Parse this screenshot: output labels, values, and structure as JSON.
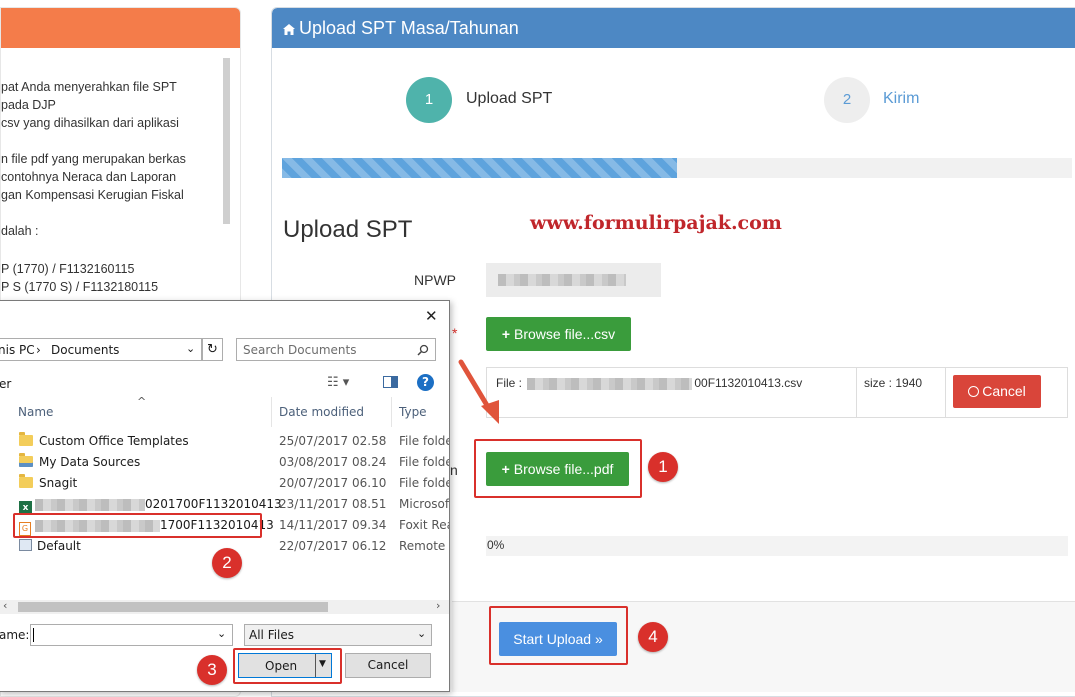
{
  "left_panel": {
    "lines": [
      "pat Anda menyerahkan file SPT",
      "pada DJP",
      "csv yang dihasilkan dari aplikasi",
      "n file pdf yang merupakan berkas",
      "contohnya Neraca dan Laporan",
      "gan Kompensasi Kerugian Fiskal",
      "dalah :",
      "P (1770) / F1132160115",
      "P S (1770 S) / F1132180115"
    ]
  },
  "card": {
    "title": "Upload SPT Masa/Tahunan",
    "steps": [
      {
        "number": "1",
        "label": "Upload SPT"
      },
      {
        "number": "2",
        "label": "Kirim"
      }
    ],
    "progress_percent": 50,
    "watermark": "www.formulirpajak.com",
    "section_title": "Upload SPT",
    "npwp_label": "NPWP",
    "required_mark": "*",
    "browse_csv_label": "Browse file...csv",
    "file_name": "File :",
    "file_name_suffix": "00F1132010413.csv",
    "file_size": "size : 1940",
    "cancel_label": "Cancel",
    "pdf_row_label_tail": "n",
    "browse_pdf_label": "Browse file...pdf",
    "upload_progress": "0%",
    "start_upload_label": "Start Upload »"
  },
  "annotations": {
    "badges": [
      "1",
      "2",
      "3",
      "4"
    ]
  },
  "dialog": {
    "breadcrumb_partial": "nis PC",
    "breadcrumb_current": "Documents",
    "search_placeholder": "Search Documents",
    "toolbar_partial": "er",
    "columns": {
      "name": "Name",
      "date": "Date modified",
      "type": "Type"
    },
    "files": [
      {
        "name": "Custom Office Templates",
        "date": "25/07/2017 02.58",
        "type": "File folder",
        "icon": "folder-icon"
      },
      {
        "name": "My Data Sources",
        "date": "03/08/2017 08.24",
        "type": "File folder",
        "icon": "data-source-folder-icon"
      },
      {
        "name": "Snagit",
        "date": "20/07/2017 06.10",
        "type": "File folder",
        "icon": "folder-icon"
      },
      {
        "name": "0201700F1132010413",
        "date": "23/11/2017 08.51",
        "type": "Microsoft",
        "icon": "excel-file-icon"
      },
      {
        "name": "1700F1132010413",
        "date": "14/11/2017 09.34",
        "type": "Foxit Read",
        "icon": "pdf-file-icon"
      },
      {
        "name": "Default",
        "date": "22/07/2017 06.12",
        "type": "Remote D",
        "icon": "remote-desktop-icon"
      }
    ],
    "filename_label_partial": "ame:",
    "filename_value": "",
    "filter_value": "All Files",
    "open_label": "Open",
    "cancel_label": "Cancel"
  },
  "colors": {
    "header_blue": "#4d88c4",
    "left_header_orange": "#f47c4a",
    "step_active": "#4fb3ab",
    "button_green": "#3a9c3c",
    "button_red": "#d9453a",
    "button_blue": "#4a8fe0",
    "annotation_red": "#d9302b"
  }
}
